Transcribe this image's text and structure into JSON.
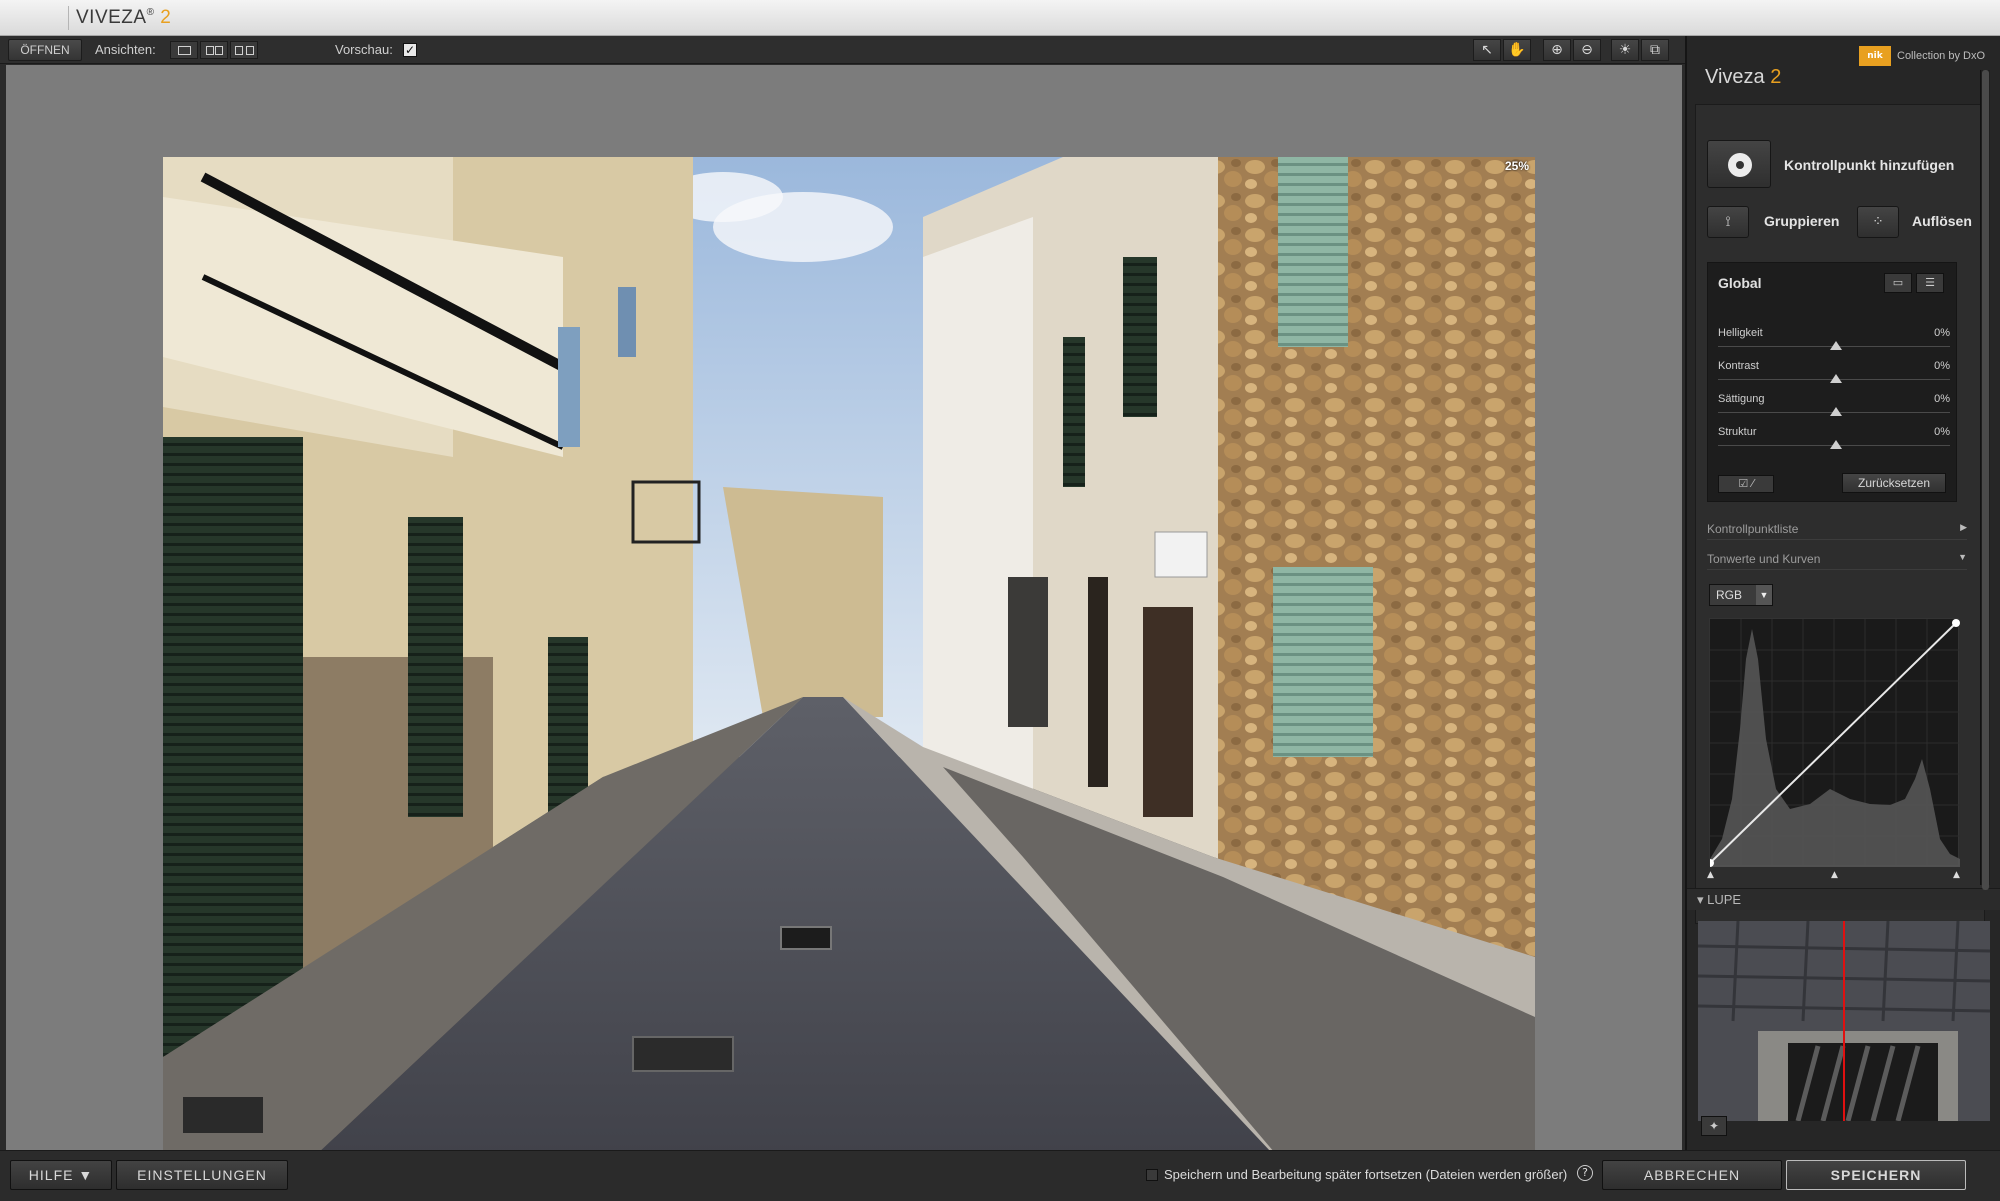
{
  "app": {
    "name": "VIVEZA",
    "sup": "®",
    "version": "2"
  },
  "toolbar": {
    "open_label": "ÖFFNEN",
    "views_label": "Ansichten:",
    "preview_label": "Vorschau:",
    "preview_checked": "✓"
  },
  "canvas": {
    "zoom": "25%"
  },
  "panel": {
    "brand_chip": "nik",
    "brand_text": "Collection by DxO",
    "title": "Viveza",
    "title_num": "2",
    "add_cp_label": "Kontrollpunkt hinzufügen",
    "group_label": "Gruppieren",
    "ungroup_label": "Auflösen",
    "global": {
      "title": "Global",
      "sliders": [
        {
          "name": "Helligkeit",
          "value": "0%"
        },
        {
          "name": "Kontrast",
          "value": "0%"
        },
        {
          "name": "Sättigung",
          "value": "0%"
        },
        {
          "name": "Struktur",
          "value": "0%"
        }
      ],
      "reset_label": "Zurücksetzen"
    },
    "cp_list_label": "Kontrollpunktliste",
    "tones_label": "Tonwerte und Kurven",
    "channel": "RGB",
    "lupe_label": "LUPE"
  },
  "bottom": {
    "help_label": "HILFE ▼",
    "settings_label": "EINSTELLUNGEN",
    "save_later_label": "Speichern und Bearbeitung später fortsetzen (Dateien werden größer)",
    "cancel_label": "ABBRECHEN",
    "save_label": "SPEICHERN"
  },
  "colors": {
    "accent": "#e8a020",
    "panel": "#262626",
    "canvas": "#7c7c7c"
  }
}
